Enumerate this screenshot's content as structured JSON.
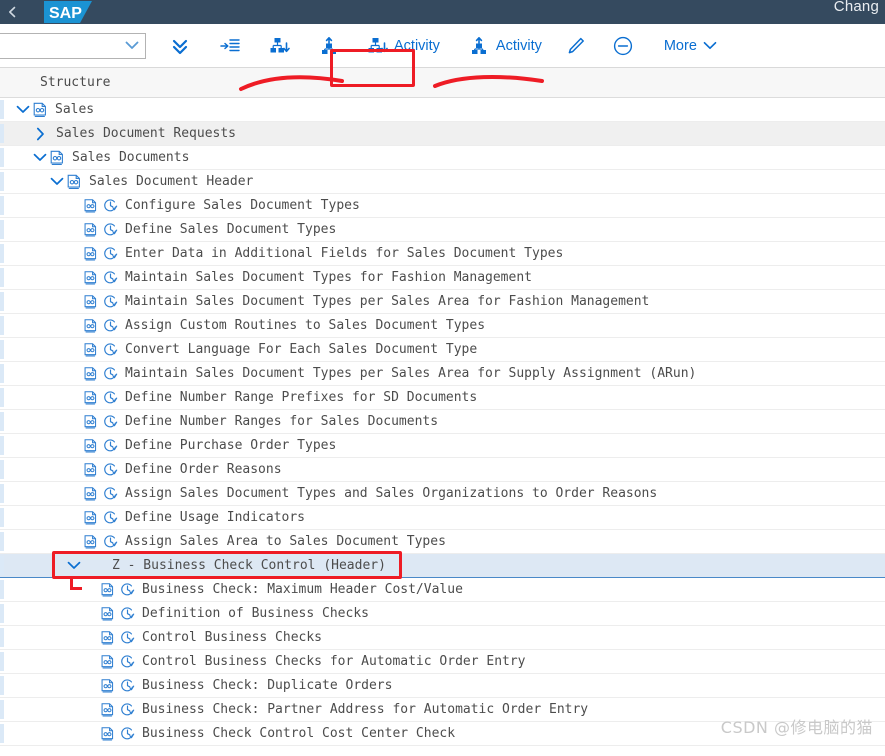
{
  "shell": {
    "title_partial": "Chang",
    "logo_alt": "sap-logo",
    "back_icon": "back-arrow-icon"
  },
  "toolbar": {
    "combo_value": "",
    "combo_placeholder": "",
    "buttons": [
      {
        "name": "collapse-all",
        "icon": "double-chevron-down-icon",
        "label": ""
      },
      {
        "name": "expand-to-level",
        "icon": "indent-list-icon",
        "label": ""
      },
      {
        "name": "expand-node",
        "icon": "hierarchy-down-icon",
        "label": ""
      },
      {
        "name": "collapse-node",
        "icon": "hierarchy-up-icon",
        "label": ""
      },
      {
        "name": "activity-create",
        "icon": "hierarchy-down-icon",
        "label": "Activity"
      },
      {
        "name": "activity-display",
        "icon": "hierarchy-up-icon",
        "label": "Activity"
      },
      {
        "name": "edit",
        "icon": "pencil-icon",
        "label": ""
      },
      {
        "name": "delete",
        "icon": "minus-circle-icon",
        "label": ""
      },
      {
        "name": "more",
        "icon": "chevron-down-icon",
        "label": "More"
      }
    ]
  },
  "table": {
    "header": {
      "structure": "Structure"
    },
    "rows": [
      {
        "label": "Sales",
        "indent": 0,
        "twisty": "down",
        "icons": [
          "structure-node-icon"
        ],
        "state": "normal"
      },
      {
        "label": "Sales Document Requests",
        "indent": 1,
        "twisty": "right",
        "icons": [],
        "state": "alt"
      },
      {
        "label": "Sales Documents",
        "indent": 1,
        "twisty": "down",
        "icons": [
          "structure-node-icon"
        ],
        "state": "normal"
      },
      {
        "label": "Sales Document Header",
        "indent": 2,
        "twisty": "down",
        "icons": [
          "structure-node-icon"
        ],
        "state": "normal"
      },
      {
        "label": "Configure Sales Document Types",
        "indent": 3,
        "twisty": "none",
        "icons": [
          "activity-doc-icon",
          "clock-icon"
        ],
        "state": "normal"
      },
      {
        "label": "Define Sales Document Types",
        "indent": 3,
        "twisty": "none",
        "icons": [
          "activity-doc-icon",
          "clock-icon"
        ],
        "state": "normal"
      },
      {
        "label": "Enter Data in Additional Fields for Sales Document Types",
        "indent": 3,
        "twisty": "none",
        "icons": [
          "activity-doc-icon",
          "clock-icon"
        ],
        "state": "normal"
      },
      {
        "label": "Maintain Sales Document Types for Fashion Management",
        "indent": 3,
        "twisty": "none",
        "icons": [
          "activity-doc-icon",
          "clock-icon"
        ],
        "state": "normal"
      },
      {
        "label": "Maintain Sales Document Types per Sales Area for Fashion Management",
        "indent": 3,
        "twisty": "none",
        "icons": [
          "activity-doc-icon",
          "clock-icon"
        ],
        "state": "normal"
      },
      {
        "label": "Assign Custom Routines to Sales Document Types",
        "indent": 3,
        "twisty": "none",
        "icons": [
          "activity-doc-icon",
          "clock-icon"
        ],
        "state": "normal"
      },
      {
        "label": "Convert Language For Each Sales Document Type",
        "indent": 3,
        "twisty": "none",
        "icons": [
          "activity-doc-icon",
          "clock-icon"
        ],
        "state": "normal"
      },
      {
        "label": "Maintain Sales Document Types per Sales Area for Supply Assignment (ARun)",
        "indent": 3,
        "twisty": "none",
        "icons": [
          "activity-doc-icon",
          "clock-icon"
        ],
        "state": "normal"
      },
      {
        "label": "Define Number Range Prefixes for SD Documents",
        "indent": 3,
        "twisty": "none",
        "icons": [
          "activity-doc-icon",
          "clock-icon"
        ],
        "state": "normal"
      },
      {
        "label": "Define Number Ranges for Sales Documents",
        "indent": 3,
        "twisty": "none",
        "icons": [
          "activity-doc-icon",
          "clock-icon"
        ],
        "state": "normal"
      },
      {
        "label": "Define Purchase Order Types",
        "indent": 3,
        "twisty": "none",
        "icons": [
          "activity-doc-icon",
          "clock-icon"
        ],
        "state": "normal"
      },
      {
        "label": "Define Order Reasons",
        "indent": 3,
        "twisty": "none",
        "icons": [
          "activity-doc-icon",
          "clock-icon"
        ],
        "state": "normal"
      },
      {
        "label": "Assign Sales Document Types and Sales Organizations to Order Reasons",
        "indent": 3,
        "twisty": "none",
        "icons": [
          "activity-doc-icon",
          "clock-icon"
        ],
        "state": "normal"
      },
      {
        "label": "Define Usage Indicators",
        "indent": 3,
        "twisty": "none",
        "icons": [
          "activity-doc-icon",
          "clock-icon"
        ],
        "state": "normal"
      },
      {
        "label": "Assign Sales Area to Sales Document Types",
        "indent": 3,
        "twisty": "none",
        "icons": [
          "activity-doc-icon",
          "clock-icon"
        ],
        "state": "normal"
      },
      {
        "label": "Z - Business Check Control (Header)",
        "indent": 3,
        "twisty": "down",
        "icons": [],
        "state": "selected"
      },
      {
        "label": "Business Check: Maximum Header Cost/Value",
        "indent": 4,
        "twisty": "none",
        "icons": [
          "activity-doc-icon",
          "clock-icon"
        ],
        "state": "normal"
      },
      {
        "label": "Definition of Business Checks",
        "indent": 4,
        "twisty": "none",
        "icons": [
          "activity-doc-icon",
          "clock-icon"
        ],
        "state": "normal"
      },
      {
        "label": "Control Business Checks",
        "indent": 4,
        "twisty": "none",
        "icons": [
          "activity-doc-icon",
          "clock-icon"
        ],
        "state": "normal"
      },
      {
        "label": "Control Business Checks for Automatic Order Entry",
        "indent": 4,
        "twisty": "none",
        "icons": [
          "activity-doc-icon",
          "clock-icon"
        ],
        "state": "normal"
      },
      {
        "label": "Business Check: Duplicate Orders",
        "indent": 4,
        "twisty": "none",
        "icons": [
          "activity-doc-icon",
          "clock-icon"
        ],
        "state": "normal"
      },
      {
        "label": "Business Check: Partner Address for Automatic Order Entry",
        "indent": 4,
        "twisty": "none",
        "icons": [
          "activity-doc-icon",
          "clock-icon"
        ],
        "state": "normal"
      },
      {
        "label": "Business Check Control Cost Center Check",
        "indent": 4,
        "twisty": "none",
        "icons": [
          "activity-doc-icon",
          "clock-icon"
        ],
        "state": "normal"
      }
    ]
  },
  "annotations": {
    "highlight_color": "#ee1c25",
    "boxed_toolbar_button": "Activity",
    "boxed_row": "Z - Business Check Control (Header)"
  },
  "watermark": {
    "text": "CSDN @修电脑的猫"
  },
  "colors": {
    "shell_bg": "#354a5f",
    "accent": "#0a6ed1",
    "row_alt": "#f0f0f0",
    "row_selected": "#dde8f4",
    "header_bg": "#f7f7f7"
  }
}
